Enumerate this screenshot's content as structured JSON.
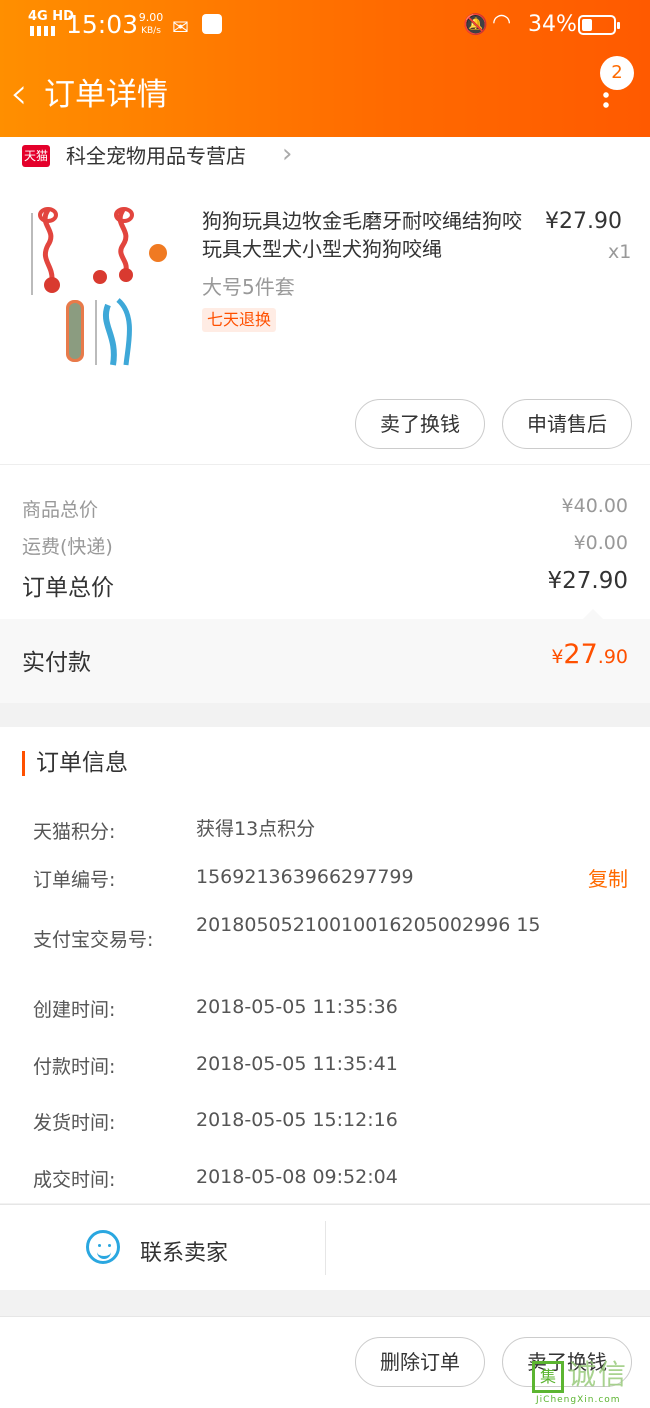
{
  "status_bar": {
    "network": "4G HD",
    "time": "15:03",
    "speed_value": "9.00",
    "speed_unit": "KB/s",
    "battery": "34%",
    "battery_level": 0.34
  },
  "nav": {
    "title": "订单详情",
    "badge_count": "2"
  },
  "store": {
    "icon_text": "天猫",
    "name": "科全宠物用品专营店"
  },
  "product": {
    "title": "狗狗玩具边牧金毛磨牙耐咬绳结狗咬玩具大型犬小型犬狗狗咬绳",
    "price": "¥27.90",
    "qty": "x1",
    "sku": "大号5件套",
    "tag": "七天退换",
    "sell_button": "卖了换钱",
    "aftersale_button": "申请售后"
  },
  "summary": {
    "goods_total_label": "商品总价",
    "goods_total_value": "¥40.00",
    "shipping_label": "运费(快递)",
    "shipping_value": "¥0.00",
    "order_total_label": "订单总价",
    "order_total_value": "¥27.90",
    "paid_label": "实付款",
    "paid_symbol": "¥",
    "paid_int": "27",
    "paid_dec": ".90"
  },
  "order_info": {
    "title": "订单信息",
    "rows": [
      {
        "key": "天猫积分:",
        "value": "获得13点积分"
      },
      {
        "key": "订单编号:",
        "value": "156921363966297799"
      },
      {
        "key": "支付宝交易号:",
        "value": "20180505210010016205002996 15"
      },
      {
        "key": "创建时间:",
        "value": "2018-05-05 11:35:36"
      },
      {
        "key": "付款时间:",
        "value": "2018-05-05 11:35:41"
      },
      {
        "key": "发货时间:",
        "value": "2018-05-05 15:12:16"
      },
      {
        "key": "成交时间:",
        "value": "2018-05-08 09:52:04"
      }
    ],
    "copy_label": "复制"
  },
  "contact": {
    "label": "联系卖家"
  },
  "bottom_actions": {
    "delete_order": "删除订单",
    "sell": "卖了换钱"
  },
  "watermark": {
    "box": "集",
    "cn": "诚信",
    "en": "JiChengXin.com"
  }
}
